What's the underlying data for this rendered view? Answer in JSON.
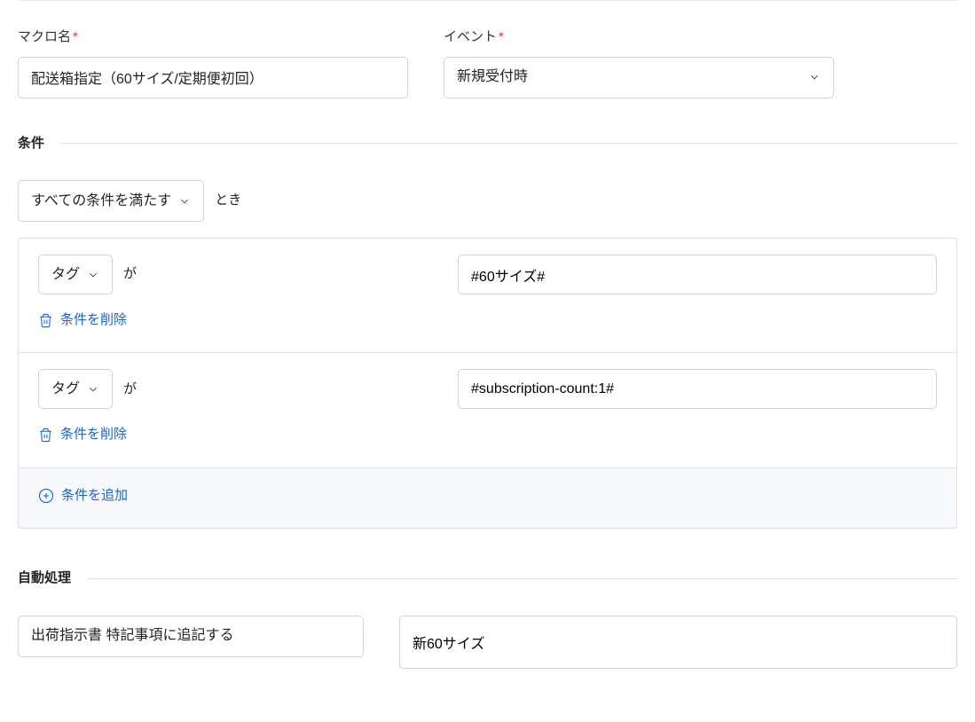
{
  "fields": {
    "macro_name_label": "マクロ名",
    "macro_name_value": "配送箱指定（60サイズ/定期便初回）",
    "event_label": "イベント",
    "event_value": "新規受付時"
  },
  "sections": {
    "conditions_title": "条件",
    "auto_process_title": "自動処理"
  },
  "condition_meta": {
    "all_conditions_label": "すべての条件を満たす",
    "suffix_toki": "とき",
    "add_label": "条件を追加",
    "delete_label": "条件を削除",
    "field_tag": "タグ",
    "ga": "が"
  },
  "conditions": [
    {
      "value": "#60サイズ#"
    },
    {
      "value": "#subscription-count:1#"
    }
  ],
  "auto_process": {
    "action_label": "出荷指示書 特記事項に追記する",
    "action_value": "新60サイズ"
  }
}
